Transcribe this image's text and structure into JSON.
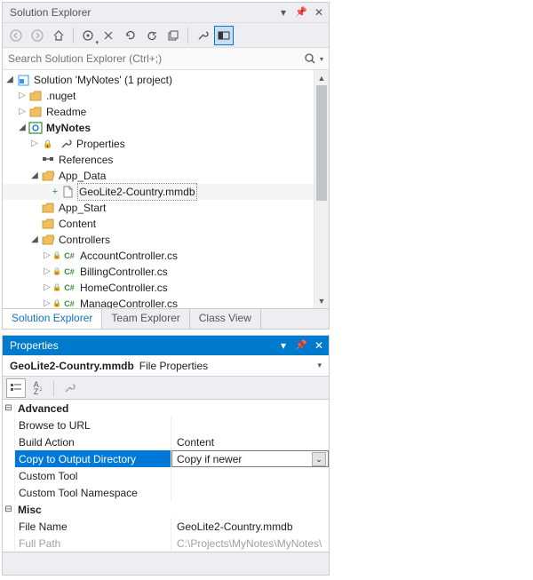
{
  "solution_explorer": {
    "title": "Solution Explorer",
    "search_placeholder": "Search Solution Explorer (Ctrl+;)",
    "tree": {
      "solution": "Solution 'MyNotes' (1 project)",
      "nuget": ".nuget",
      "readme": "Readme",
      "project": "MyNotes",
      "properties": "Properties",
      "references": "References",
      "app_data": "App_Data",
      "geolite_file": "GeoLite2-Country.mmdb",
      "app_start": "App_Start",
      "content": "Content",
      "controllers": "Controllers",
      "account": "AccountController.cs",
      "billing": "BillingController.cs",
      "home": "HomeController.cs",
      "manage": "ManageController.cs"
    }
  },
  "tabs": {
    "solution": "Solution Explorer",
    "team": "Team Explorer",
    "classview": "Class View"
  },
  "properties": {
    "title": "Properties",
    "object_name": "GeoLite2-Country.mmdb",
    "object_type": "File Properties",
    "cat_advanced": "Advanced",
    "browse_to_url": {
      "label": "Browse to URL",
      "value": ""
    },
    "build_action": {
      "label": "Build Action",
      "value": "Content"
    },
    "copy_output": {
      "label": "Copy to Output Directory",
      "value": "Copy if newer"
    },
    "custom_tool": {
      "label": "Custom Tool",
      "value": ""
    },
    "custom_tool_ns": {
      "label": "Custom Tool Namespace",
      "value": ""
    },
    "cat_misc": "Misc",
    "file_name": {
      "label": "File Name",
      "value": "GeoLite2-Country.mmdb"
    },
    "full_path": {
      "label": "Full Path",
      "value": "C:\\Projects\\MyNotes\\MyNotes\\"
    }
  }
}
